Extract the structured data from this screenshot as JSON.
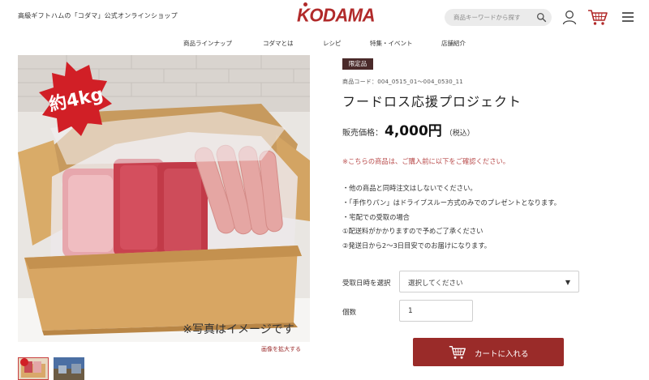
{
  "header": {
    "tagline": "高級ギフトハムの「コダマ」公式オンラインショップ",
    "logo_text": "KODAMA",
    "search_placeholder": "商品キーワードから探す",
    "icons": [
      "search-icon",
      "user-icon",
      "cart-icon",
      "hamburger-menu-icon"
    ],
    "brand_color": "#b12a2a"
  },
  "nav": {
    "items": [
      {
        "label": "商品ラインナップ"
      },
      {
        "label": "コダマとは"
      },
      {
        "label": "レシピ"
      },
      {
        "label": "特集・イベント"
      },
      {
        "label": "店舗紹介"
      }
    ]
  },
  "gallery": {
    "photo_badge_text": "約4kg",
    "photo_caption": "※写真はイメージです",
    "zoom_link": "画像を拡大する"
  },
  "product": {
    "badge": "限定品",
    "code": "商品コード：004_0515_01～004_0530_11",
    "title": "フードロス応援プロジェクト",
    "price_label": "販売価格：",
    "price_value": "4,000円",
    "price_tax": "（税込）",
    "notice": "※こちらの商品は、ご購入前に以下をご確認ください。",
    "notes": [
      "・他の商品と同時注文はしないでください。",
      "・「手作りパン」はドライブスルー方式のみでのプレゼントとなります。",
      "・宅配での受取の場合",
      "①配送料がかかりますので予めご了承ください",
      "②発送日から2～3日目安でのお届けになります。"
    ]
  },
  "form": {
    "date_label": "受取日時を選択",
    "date_selected": "選択してください",
    "qty_label": "個数",
    "qty_value": "1"
  },
  "cart_button": {
    "label": "カートに入れる",
    "color": "#9a2b29"
  }
}
